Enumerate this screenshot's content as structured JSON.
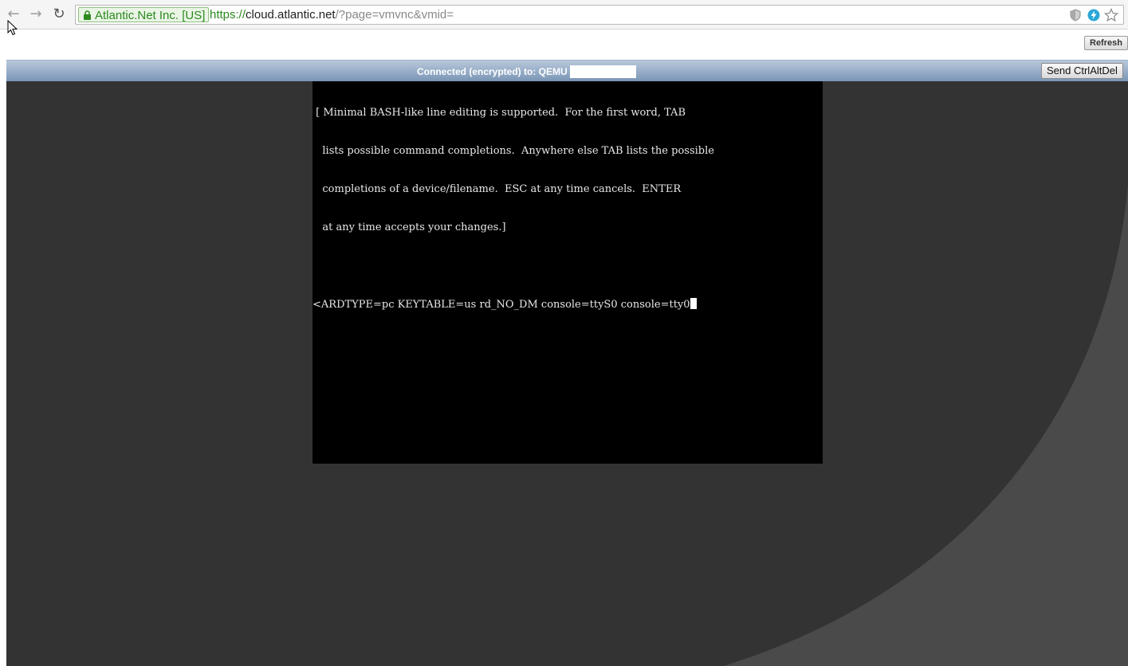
{
  "browser": {
    "ev_label": "Atlantic.Net Inc. [US]",
    "url_scheme": "https://",
    "url_host": "cloud.atlantic.net",
    "url_rest": "/?page=vmvnc&vmid=",
    "icons": [
      "back-arrow-icon",
      "forward-arrow-icon",
      "reload-icon",
      "lock-icon",
      "shield-icon",
      "bolt-icon",
      "star-icon"
    ]
  },
  "page": {
    "refresh_label": "Refresh"
  },
  "vnc": {
    "status_text": "Connected (encrypted) to: QEMU",
    "ctrlaltdel_label": "Send CtrlAltDel",
    "console_lines": [
      " [ Minimal BASH-like line editing is supported.  For the first word, TAB",
      "   lists possible command completions.  Anywhere else TAB lists the possible",
      "   completions of a device/filename.  ESC at any time cancels.  ENTER",
      "   at any time accepts your changes.]",
      "",
      "<ARDTYPE=pc KEYTABLE=us rd_NO_DM console=ttyS0 console=tty0"
    ]
  },
  "colors": {
    "vnc_bar": "#7a95b6",
    "vnc_bg": "#333333",
    "vnc_curve": "#4a4a4a",
    "ev_green": "#2c8a1e"
  }
}
